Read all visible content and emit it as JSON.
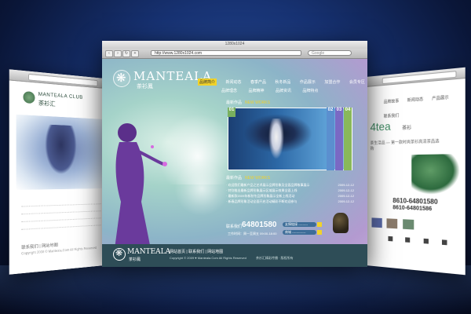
{
  "main_window": {
    "title": "1280x1024",
    "url": "http://www.1280x1024.com",
    "search_placeholder": "Google",
    "brand": "MANTEALA",
    "brand_cn": "茶衫鳳",
    "top_nav": [
      "品牌简介",
      "新闻动态",
      "春季产品",
      "秋冬新品",
      "作品展示",
      "加盟合作",
      "会员专区"
    ],
    "sub_nav": [
      "品牌理念",
      "品牌精神",
      "品牌资讯",
      "品牌特点"
    ],
    "new_works": {
      "label": "最新作品",
      "label_en": "NEW WORKS"
    },
    "carousel_tabs": [
      "01",
      "02",
      "03",
      "04"
    ],
    "news": {
      "label": "最新作品",
      "label_en": "NEW WORKS",
      "items": [
        {
          "text": "欢迎我们最新产品之艺术展示品牌形象及全面品牌故事展示",
          "date": "2009-12-12"
        },
        {
          "text": "特别推出最新品牌形象展示区域展示效果全面上线",
          "date": "2009-12-12"
        },
        {
          "text": "最新款2009年新秋冬品牌形象展示全新上线活动",
          "date": "2009-12-12"
        },
        {
          "text": "新春品牌形象活动全面开启活动精彩不断欢迎参与",
          "date": "2009-12-12"
        }
      ]
    },
    "contact": {
      "label": "联系我们",
      "phone": "64801580",
      "hours": "工作时间：周一至周五 09:00-18:00",
      "pill1": "友情链接 ---------",
      "pill2": "商城 -------------"
    },
    "footer": {
      "brand": "MANTEALA",
      "brand_cn": "茶衫鳳",
      "links": "网站首页 | 联系我们 | 网站地图",
      "copyright": "Copyright © 2009 ♥ Manteala.Com All Rights Reserved",
      "right_text": "茶衫汇精彩传播 · 版权所有"
    }
  },
  "left_window": {
    "brand": "MANTEALA CLUB",
    "brand_cn": "茶衫汇",
    "footer_links": "联系我们 | 网站地图",
    "footer_copy": "Copyright 2008 © Manteala.Com All Rights Reserved"
  },
  "right_window": {
    "top_links": [
      "品牌故事",
      "新闻动态",
      "产品展示",
      "联系我们"
    ],
    "brand": "4tea",
    "brand_cn": "茶衫",
    "desc": "茶生活品 — 第一款时尚茶衫高清茶品选购",
    "phone": "8610-64801580",
    "phone2": "8610-64801586"
  },
  "colors": {
    "accent_yellow": "#f1d22a",
    "footer_teal": "#2e4d57",
    "background_blue": "#173272"
  },
  "icons": {
    "logo": "lotus-emblem-icon",
    "nav_back": "arrow-left-icon",
    "nav_forward": "arrow-right-icon"
  }
}
